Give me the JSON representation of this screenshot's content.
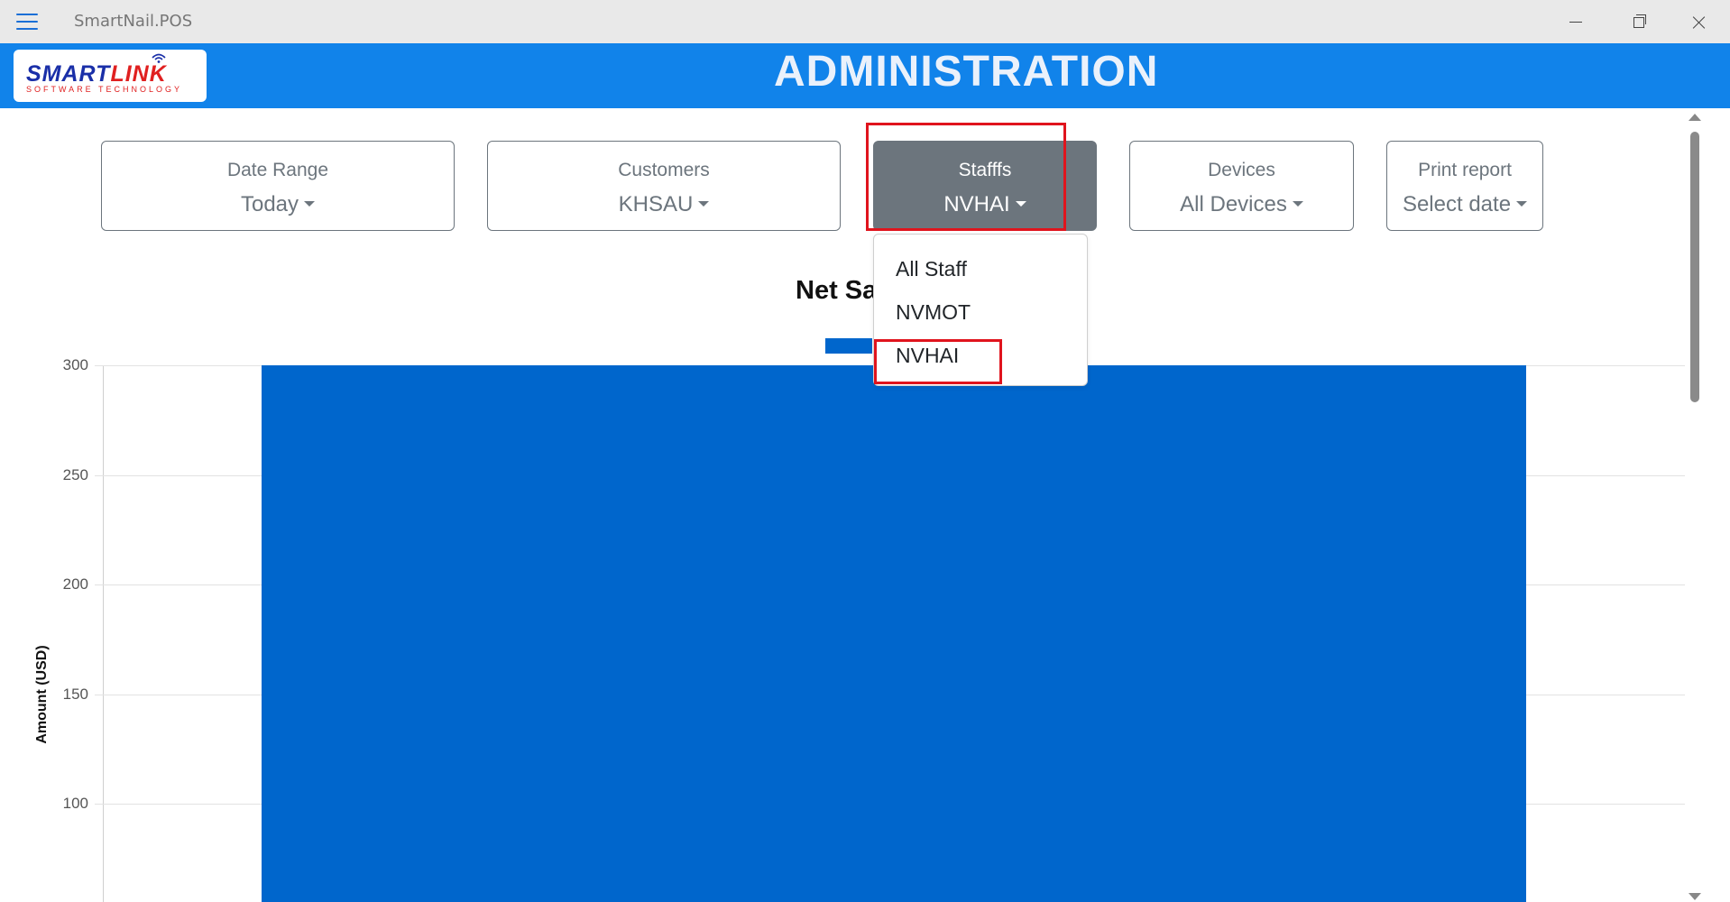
{
  "window": {
    "title": "SmartNail.POS"
  },
  "header": {
    "title": "ADMINISTRATION",
    "logo": {
      "main_a": "SMART",
      "main_b": "LINK",
      "sub": "SOFTWARE TECHNOLOGY"
    }
  },
  "filters": {
    "date_range": {
      "label": "Date Range",
      "value": "Today"
    },
    "customers": {
      "label": "Customers",
      "value": "KHSAU"
    },
    "staffs": {
      "label": "Stafffs",
      "value": "NVHAI"
    },
    "devices": {
      "label": "Devices",
      "value": "All Devices"
    },
    "print_report": {
      "label": "Print report",
      "value": "Select date"
    }
  },
  "staff_dropdown": {
    "items": [
      "All Staff",
      "NVMOT",
      "NVHAI"
    ]
  },
  "colors": {
    "accent": "#1183ea",
    "bar": "#0066cc",
    "highlight": "#e0141d",
    "active_button": "#6c757d"
  },
  "chart_data": {
    "type": "bar",
    "title": "Net Sa",
    "ylabel": "Amount (USD)",
    "yticks": [
      300,
      250,
      200,
      150,
      100
    ],
    "series": [
      {
        "values": [
          300
        ]
      }
    ],
    "ylim_visible": [
      75,
      300
    ],
    "grid": true,
    "legend": "top-center"
  }
}
